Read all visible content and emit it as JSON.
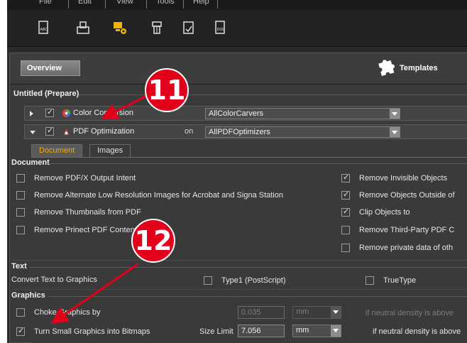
{
  "menu": [
    "File",
    "Edit",
    "View",
    "Tools",
    "Help"
  ],
  "toolbar_icons": [
    "abc-document-icon",
    "printer-icon",
    "computer-gear-icon",
    "processor-icon",
    "checked-document-icon",
    "doc-file-icon"
  ],
  "topbar": {
    "overview_label": "Overview",
    "templates_label": "Templates"
  },
  "section_title": "Untitled (Prepare)",
  "rows": {
    "color": {
      "label": "Color Conversion",
      "dropdown": "AllColorCarvers"
    },
    "pdf": {
      "label": "PDF Optimization",
      "on": "on",
      "dropdown": "AllPDFOptimizers"
    }
  },
  "tabs": {
    "document": "Document",
    "images": "Images"
  },
  "document": {
    "title": "Document",
    "left": [
      {
        "label": "Remove PDF/X Output Intent",
        "checked": false
      },
      {
        "label": "Remove Alternate Low Resolution Images for Acrobat and Signa Station",
        "checked": false
      },
      {
        "label": "Remove Thumbnails from PDF",
        "checked": false
      },
      {
        "label": "Remove Prinect PDF Content",
        "checked": false
      }
    ],
    "right": [
      {
        "label": "Remove Invisible Objects",
        "checked": true
      },
      {
        "label": "Remove Objects Outside of",
        "checked": true
      },
      {
        "label": "Clip Objects to",
        "checked": true
      },
      {
        "label": "Remove Third-Party PDF C",
        "checked": false
      },
      {
        "label": "Remove private data of oth",
        "checked": false
      }
    ]
  },
  "text": {
    "title": "Text",
    "convert_label": "Convert Text to Graphics",
    "type1_label": "Type1 (PostScript)",
    "truetype_label": "TrueType"
  },
  "graphics": {
    "title": "Graphics",
    "choke": {
      "label": "Choke Graphics by",
      "value": "0.035",
      "unit": "mm",
      "neutral": "if neutral density is above",
      "checked": false
    },
    "small": {
      "label": "Turn Small Graphics into Bitmaps",
      "size_label": "Size Limit",
      "value": "7.056",
      "unit": "mm",
      "neutral": "if neutral density is above",
      "checked": true
    }
  },
  "callouts": {
    "first": "11",
    "second": "12"
  },
  "colors": {
    "callout": "#e2001a",
    "active_tab_text": "#f5a800"
  }
}
